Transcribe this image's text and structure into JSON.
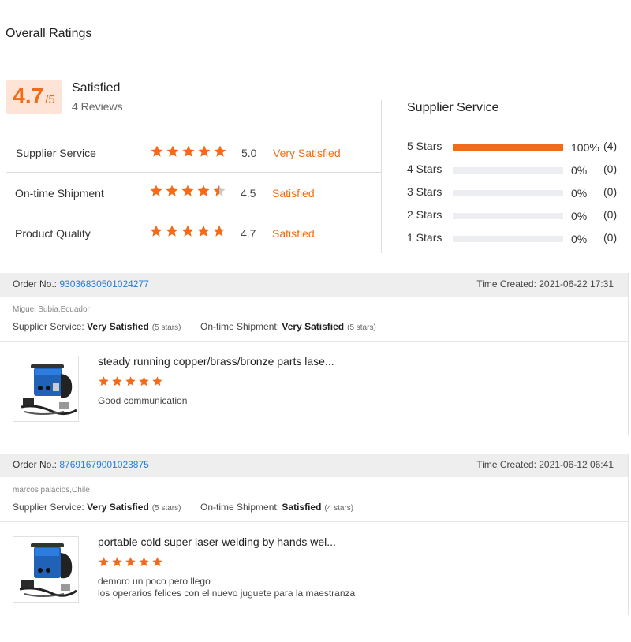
{
  "overall": {
    "title": "Overall Ratings",
    "score": "4.7",
    "score_suffix": "/5",
    "label": "Satisfied",
    "reviews": "4 Reviews"
  },
  "ratings": [
    {
      "name": "Supplier Service",
      "value": "5.0",
      "desc": "Very Satisfied",
      "stars": 5
    },
    {
      "name": "On-time Shipment",
      "value": "4.5",
      "desc": "Satisfied",
      "stars": 4.5
    },
    {
      "name": "Product Quality",
      "value": "4.7",
      "desc": "Satisfied",
      "stars": 4.7
    }
  ],
  "distribution": {
    "title": "Supplier Service",
    "rows": [
      {
        "label": "5 Stars",
        "pct": "100%",
        "count": "(4)",
        "fraction": 1.0
      },
      {
        "label": "4 Stars",
        "pct": "0%",
        "count": "(0)",
        "fraction": 0
      },
      {
        "label": "3 Stars",
        "pct": "0%",
        "count": "(0)",
        "fraction": 0
      },
      {
        "label": "2 Stars",
        "pct": "0%",
        "count": "(0)",
        "fraction": 0
      },
      {
        "label": "1 Stars",
        "pct": "0%",
        "count": "(0)",
        "fraction": 0
      }
    ]
  },
  "reviews": [
    {
      "order_label": "Order No.:",
      "order_no": "93036830501024277",
      "time": "Time Created: 2021-06-22 17:31",
      "buyer": "Miguel Subia,Ecuador",
      "svc_label": "Supplier Service:",
      "svc_value": "Very Satisfied",
      "svc_stars": "(5 stars)",
      "ship_label": "On-time Shipment:",
      "ship_value": "Very Satisfied",
      "ship_stars": "(5 stars)",
      "product": "steady running copper/brass/bronze parts lase...",
      "rating": 5,
      "comment_1": "Good communication",
      "comment_2": ""
    },
    {
      "order_label": "Order No.:",
      "order_no": "87691679001023875",
      "time": "Time Created: 2021-06-12 06:41",
      "buyer": "marcos palacios,Chile",
      "svc_label": "Supplier Service:",
      "svc_value": "Very Satisfied",
      "svc_stars": "(5 stars)",
      "ship_label": "On-time Shipment:",
      "ship_value": "Satisfied",
      "ship_stars": "(4 stars)",
      "product": "portable cold super laser welding by hands wel...",
      "rating": 5,
      "comment_1": "demoro un poco pero llego",
      "comment_2": "los operarios felices con el nuevo juguete para la maestranza"
    }
  ],
  "colors": {
    "accent": "#f36b18",
    "star_empty": "#c8c8c8",
    "link": "#2a7bd4"
  },
  "icons": {
    "star": "star-icon",
    "product": "welding-machine-image"
  }
}
